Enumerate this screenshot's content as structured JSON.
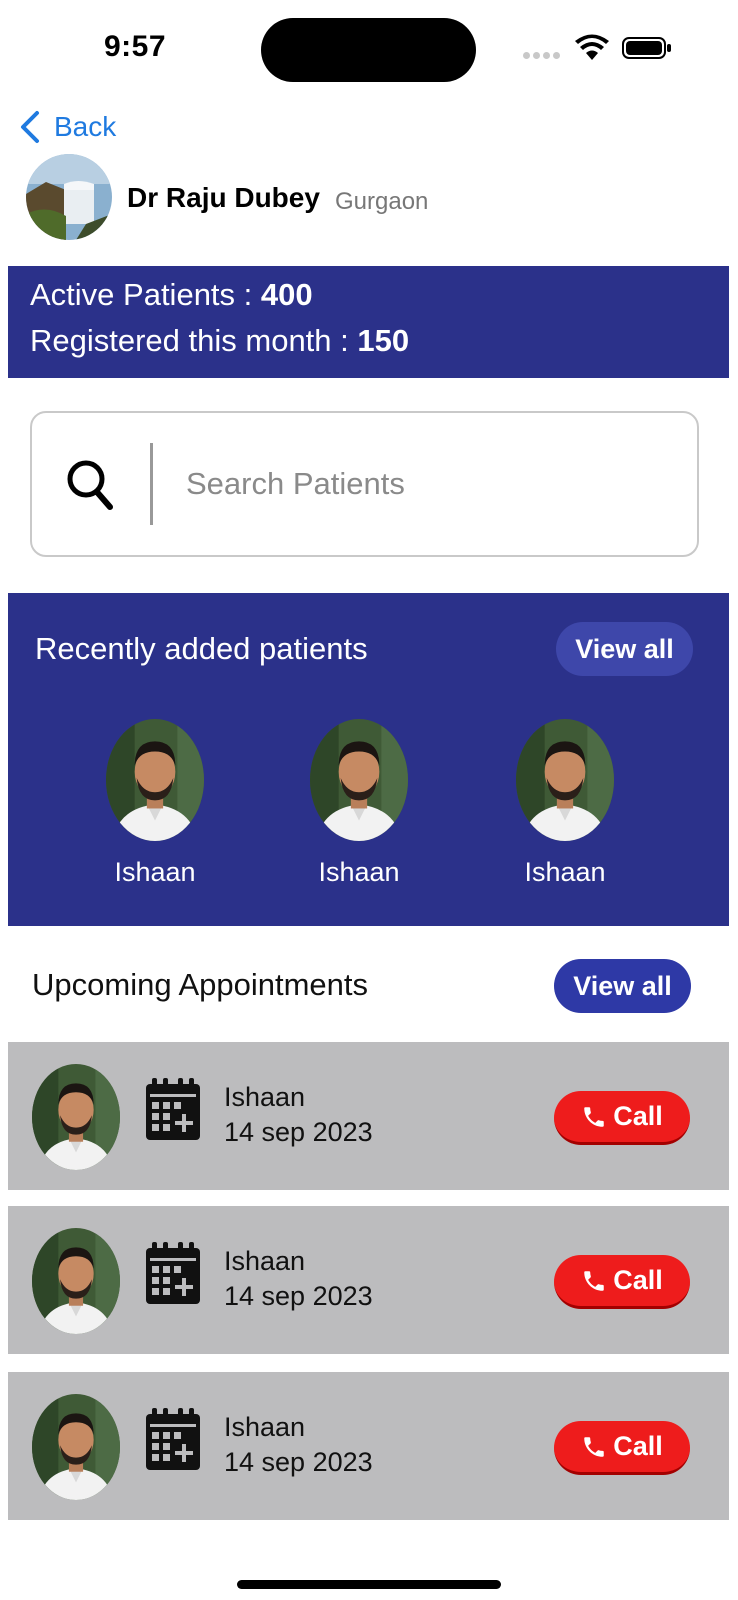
{
  "status_bar": {
    "time": "9:57"
  },
  "nav": {
    "back_label": "Back"
  },
  "doctor": {
    "name": "Dr Raju Dubey",
    "city": "Gurgaon"
  },
  "stats": {
    "active_label": "Active Patients : ",
    "active_value": "400",
    "registered_label": "Registered this month : ",
    "registered_value": "150"
  },
  "search": {
    "placeholder": "Search Patients"
  },
  "recent": {
    "title": "Recently added patients",
    "view_all_label": "View all",
    "patients": [
      {
        "name": "Ishaan"
      },
      {
        "name": "Ishaan"
      },
      {
        "name": "Ishaan"
      }
    ]
  },
  "upcoming": {
    "title": "Upcoming Appointments",
    "view_all_label": "View all",
    "appointments": [
      {
        "name": "Ishaan",
        "date": "14 sep 2023",
        "call_label": "Call"
      },
      {
        "name": "Ishaan",
        "date": "14 sep 2023",
        "call_label": "Call"
      },
      {
        "name": "Ishaan",
        "date": "14 sep 2023",
        "call_label": "Call"
      }
    ]
  },
  "colors": {
    "primary": "#2b318a",
    "link": "#1f7ae0",
    "call": "#ee1c1c",
    "card": "#bcbcbe"
  }
}
